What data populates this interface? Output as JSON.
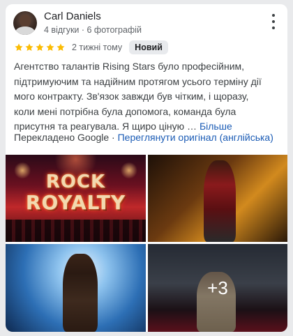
{
  "review": {
    "author": {
      "name": "Carl Daniels",
      "meta": "4 відгуки · 6 фотографій"
    },
    "rating": {
      "stars": 5,
      "max_stars": 5,
      "star_color": "#fbbc04",
      "time_ago": "2 тижні тому",
      "badge": "Новий"
    },
    "text_lines": [
      "Агентство талантів Rising Stars було професійним,",
      "підтримуючим та надійним протягом усього терміну дії",
      "мого контракту. Зв'язок завжди був чітким, і щоразу,",
      "коли мені потрібна була допомога, команда була",
      "присутня та реагувала. Я щиро ціную …"
    ],
    "more_label": "Більше",
    "translated_label": "Перекладено Google ·",
    "original_link": "Переглянути оригінал (англійська)"
  },
  "photos": {
    "photo1_title_line1": "ROCK",
    "photo1_title_line2": "ROYALTY",
    "more_count": "+3"
  },
  "colors": {
    "link": "#1a5bb5",
    "badge_bg": "#e8eaed",
    "secondary_text": "#5f6368"
  },
  "icons": {
    "more": "more-vert-icon",
    "star": "star-icon"
  }
}
